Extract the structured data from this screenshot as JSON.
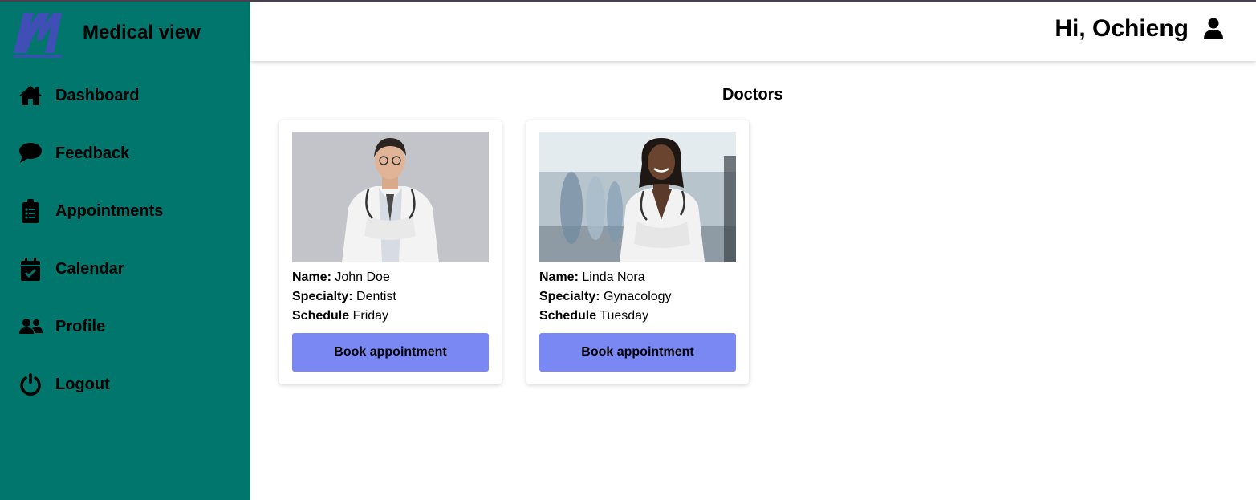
{
  "app": {
    "name": "Medical view"
  },
  "colors": {
    "sidebar": "#00766c",
    "button": "#7a88f4",
    "logo": "#3f4fb5"
  },
  "sidebar": {
    "items": [
      {
        "label": "Dashboard",
        "icon": "home-icon"
      },
      {
        "label": "Feedback",
        "icon": "comment-icon"
      },
      {
        "label": "Appointments",
        "icon": "clipboard-list-icon"
      },
      {
        "label": "Calendar",
        "icon": "calendar-check-icon"
      },
      {
        "label": "Profile",
        "icon": "users-icon"
      },
      {
        "label": "Logout",
        "icon": "power-icon"
      }
    ]
  },
  "header": {
    "greeting": "Hi, Ochieng",
    "icon": "user-icon"
  },
  "main": {
    "title": "Doctors",
    "labels": {
      "name": "Name:",
      "specialty": "Specialty:",
      "schedule": "Schedule"
    },
    "doctors": [
      {
        "name": "John Doe",
        "specialty": "Dentist",
        "schedule": "Friday",
        "button": "Book appointment"
      },
      {
        "name": "Linda Nora",
        "specialty": "Gynacology",
        "schedule": "Tuesday",
        "button": "Book appointment"
      }
    ]
  }
}
